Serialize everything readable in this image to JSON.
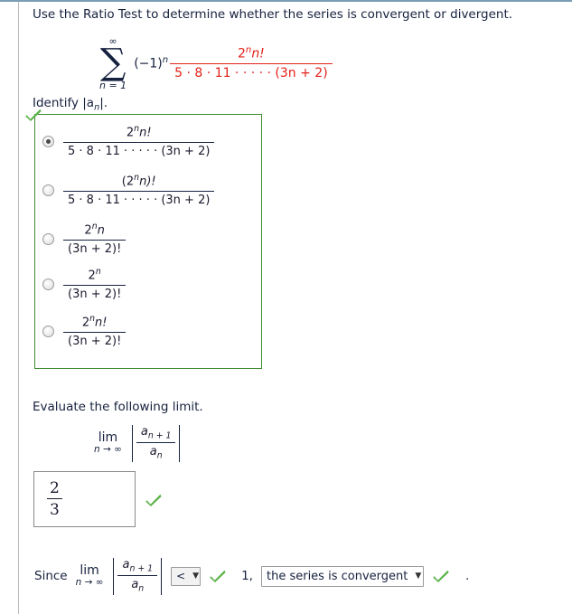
{
  "prompt": "Use the Ratio Test to determine whether the series is convergent or divergent.",
  "series": {
    "sigma_top": "∞",
    "sigma_symbol": "∑",
    "sigma_bottom": "n = 1",
    "sign_factor": "(−1)",
    "sign_exponent": "n",
    "numerator_base": "2",
    "numerator_exponent": "n",
    "numerator_rest": "n!",
    "denominator": "5 · 8 · 11 · · · · · (3n + 2)",
    "numerator_color": "#e32119",
    "denominator_color": "#e32119"
  },
  "identify_label": "Identify |a",
  "identify_sub": "n",
  "identify_label_end": "|.",
  "options": {
    "selected_index": 0,
    "items": [
      {
        "num_pre": "2",
        "num_exp": "n",
        "num_post": "n!",
        "den": "5 · 8 · 11 · · · · · (3n + 2)",
        "selected": true
      },
      {
        "num_pre": "(2",
        "num_exp": "n",
        "num_post": "n)!",
        "den": "5 · 8 · 11 · · · · · (3n + 2)",
        "selected": false
      },
      {
        "num_pre": "2",
        "num_exp": "n",
        "num_post": "n",
        "den": "(3n + 2)!",
        "selected": false
      },
      {
        "num_pre": "2",
        "num_exp": "n",
        "num_post": "",
        "den": "(3n + 2)!",
        "selected": false
      },
      {
        "num_pre": "2",
        "num_exp": "n",
        "num_post": "n!",
        "den": "(3n + 2)!",
        "selected": false
      }
    ],
    "correct_marker": "check-mark",
    "border_color": "#3f8c2f"
  },
  "evaluate": {
    "label": "Evaluate the following limit.",
    "lim_word": "lim",
    "lim_sub": "n → ∞",
    "ratio_num_a": "a",
    "ratio_num_sub": "n + 1",
    "ratio_den_a": "a",
    "ratio_den_sub": "n",
    "answer_numerator": "2",
    "answer_denominator": "3",
    "answer_marker": "check-mark"
  },
  "conclusion": {
    "since_word": "Since",
    "lim_word": "lim",
    "lim_sub": "n → ∞",
    "ratio_num_a": "a",
    "ratio_num_sub": "n + 1",
    "ratio_den_a": "a",
    "ratio_den_sub": "n",
    "comparison_value": "<",
    "comparison_caret": "▼",
    "one_text": "1,",
    "conclusion_value": "the series is convergent",
    "conclusion_caret": "▼",
    "period": ".",
    "comparison_marker": "check-mark",
    "conclusion_marker": "check-mark"
  },
  "colors": {
    "check_green": "#5cb24a",
    "box_green": "#3f8c2f",
    "math_red": "#e32119",
    "text_navy": "#16213e",
    "top_rule": "#7a9cb5"
  }
}
